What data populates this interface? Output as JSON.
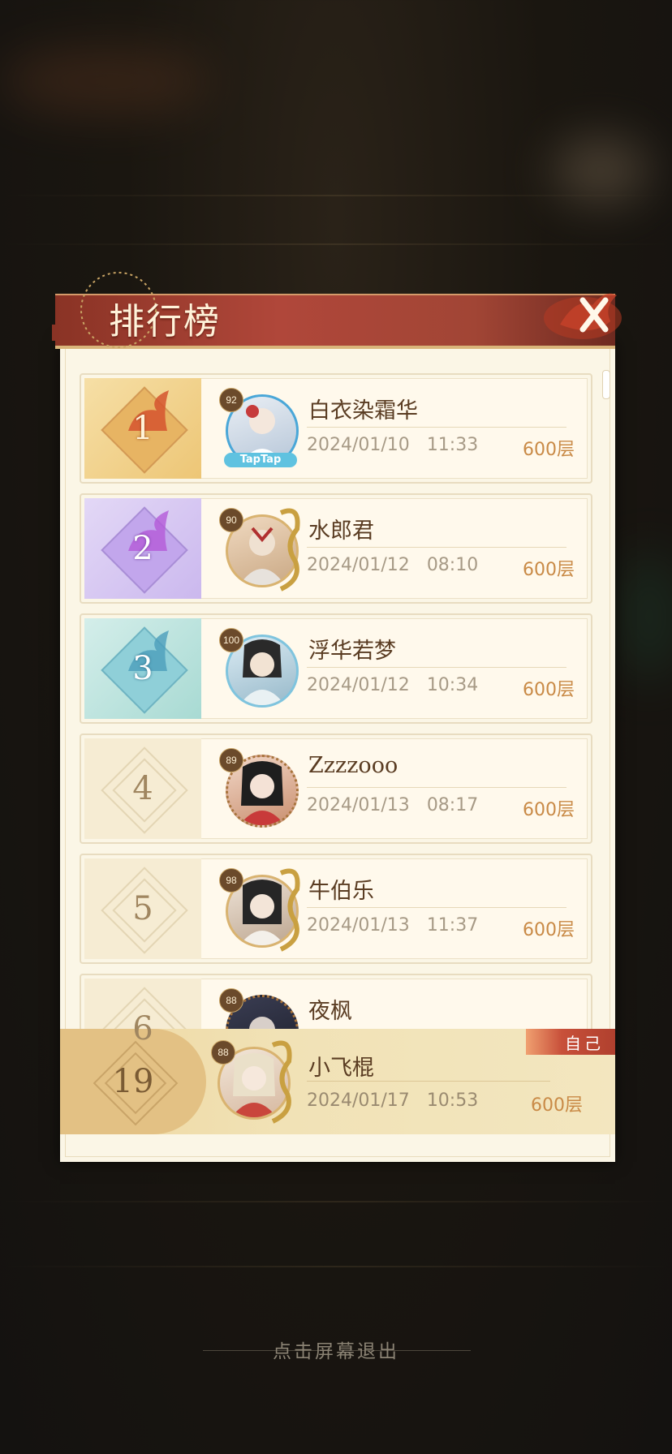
{
  "header": {
    "title": "排行榜"
  },
  "rows": [
    {
      "rank": "1",
      "level": "92",
      "name": "白衣染霜华",
      "date": "2024/01/10",
      "time": "11:33",
      "floor": "600层",
      "theme": "gold"
    },
    {
      "rank": "2",
      "level": "90",
      "name": "水郎君",
      "date": "2024/01/12",
      "time": "08:10",
      "floor": "600层",
      "theme": "purple"
    },
    {
      "rank": "3",
      "level": "100",
      "name": "浮华若梦",
      "date": "2024/01/12",
      "time": "10:34",
      "floor": "600层",
      "theme": "teal"
    },
    {
      "rank": "4",
      "level": "89",
      "name": "Zzzzooo",
      "date": "2024/01/13",
      "time": "08:17",
      "floor": "600层",
      "theme": "plain"
    },
    {
      "rank": "5",
      "level": "98",
      "name": "牛伯乐",
      "date": "2024/01/13",
      "time": "11:37",
      "floor": "600层",
      "theme": "plain"
    },
    {
      "rank": "6",
      "level": "88",
      "name": "夜枫",
      "date": "",
      "time": "",
      "floor": "",
      "theme": "plain"
    }
  ],
  "self": {
    "tag": "自己",
    "rank": "19",
    "level": "88",
    "name": "小飞棍",
    "date": "2024/01/17",
    "time": "10:53",
    "floor": "600层"
  },
  "avatar_watermark": "TapTap",
  "footer": {
    "exit_hint": "点击屏幕退出"
  },
  "colors": {
    "gold": "#f2d9a0",
    "purple": "#c9b6ef",
    "teal": "#a8dcd6",
    "banner": "#a8433a"
  }
}
